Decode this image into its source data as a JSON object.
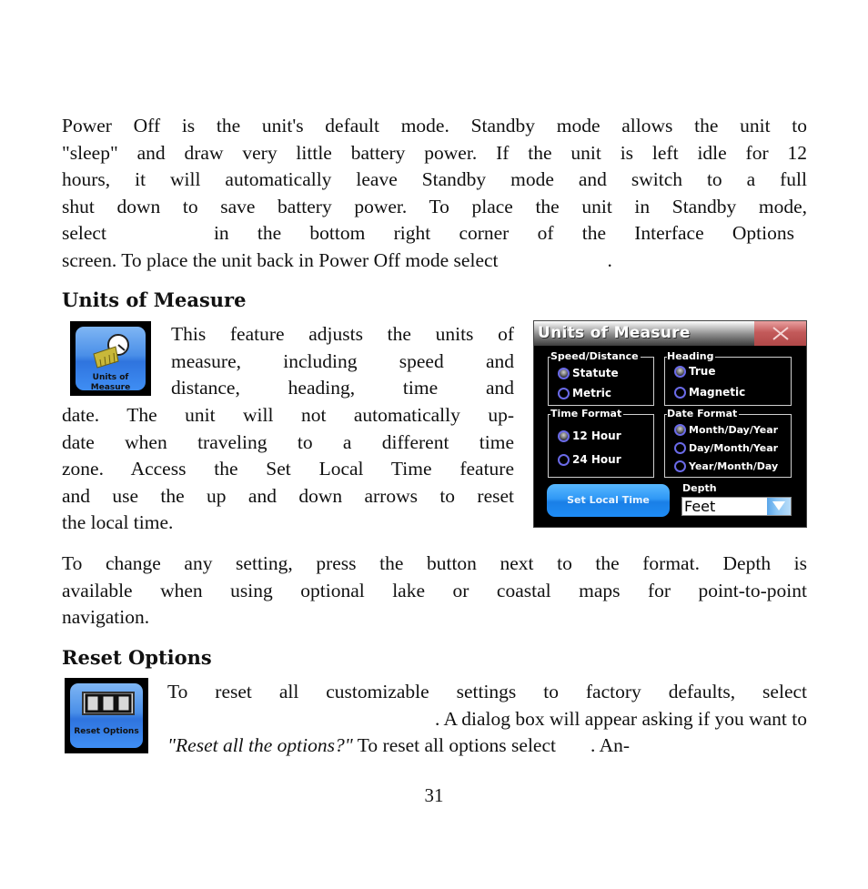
{
  "intro": {
    "lines": [
      "Power Off is the unit's default mode. Standby mode allows the unit to",
      "\"sleep\" and draw very little battery power. If the unit is left idle for 12",
      "hours, it will automatically leave Standby mode and switch to a full",
      "shut down to save battery power. To place the unit in Standby mode,"
    ],
    "line5_a": "select",
    "line5_b": "in the bottom right corner of the Interface Options",
    "line6_a": "screen. To place the unit back in Power Off mode select",
    "line6_b": "."
  },
  "units_section": {
    "heading": "Units of Measure",
    "icon_label_1": "Units of",
    "icon_label_2": "Measure",
    "body_lines": [
      "This feature adjusts the units of",
      "measure, including speed and",
      "distance, heading, time and",
      "date. The unit will not automatically up-",
      "date when traveling to a different time",
      "zone. Access the Set Local Time feature",
      "and use the up and down arrows to reset",
      "the local time."
    ],
    "after_lines": [
      "To change any setting, press the button next to the format. Depth is",
      "available when using optional lake or coastal maps for point-to-point",
      "navigation."
    ]
  },
  "device_screen": {
    "title": "Units of Measure",
    "groups": {
      "speed": {
        "title": "Speed/Distance",
        "options": [
          {
            "label": "Statute",
            "selected": true
          },
          {
            "label": "Metric",
            "selected": false
          }
        ]
      },
      "heading": {
        "title": "Heading",
        "options": [
          {
            "label": "True",
            "selected": true
          },
          {
            "label": "Magnetic",
            "selected": false
          }
        ]
      },
      "time": {
        "title": "Time Format",
        "options": [
          {
            "label": "12 Hour",
            "selected": true
          },
          {
            "label": "24 Hour",
            "selected": false
          }
        ]
      },
      "date": {
        "title": "Date Format",
        "options": [
          {
            "label": "Month/Day/Year",
            "selected": true
          },
          {
            "label": "Day/Month/Year",
            "selected": false
          },
          {
            "label": "Year/Month/Day",
            "selected": false
          }
        ]
      }
    },
    "set_local_time_label": "Set Local Time",
    "depth_label": "Depth",
    "depth_value": "Feet"
  },
  "reset_section": {
    "heading": "Reset Options",
    "icon_label": "Reset Options",
    "line1": "To reset all customizable settings to factory defaults, select",
    "line2": ". A dialog box will appear asking if you want to",
    "line3_italic": "\"Reset all the options?\"",
    "line3_a": "To reset all options select",
    "line3_b": ". An-"
  },
  "page_number": "31"
}
